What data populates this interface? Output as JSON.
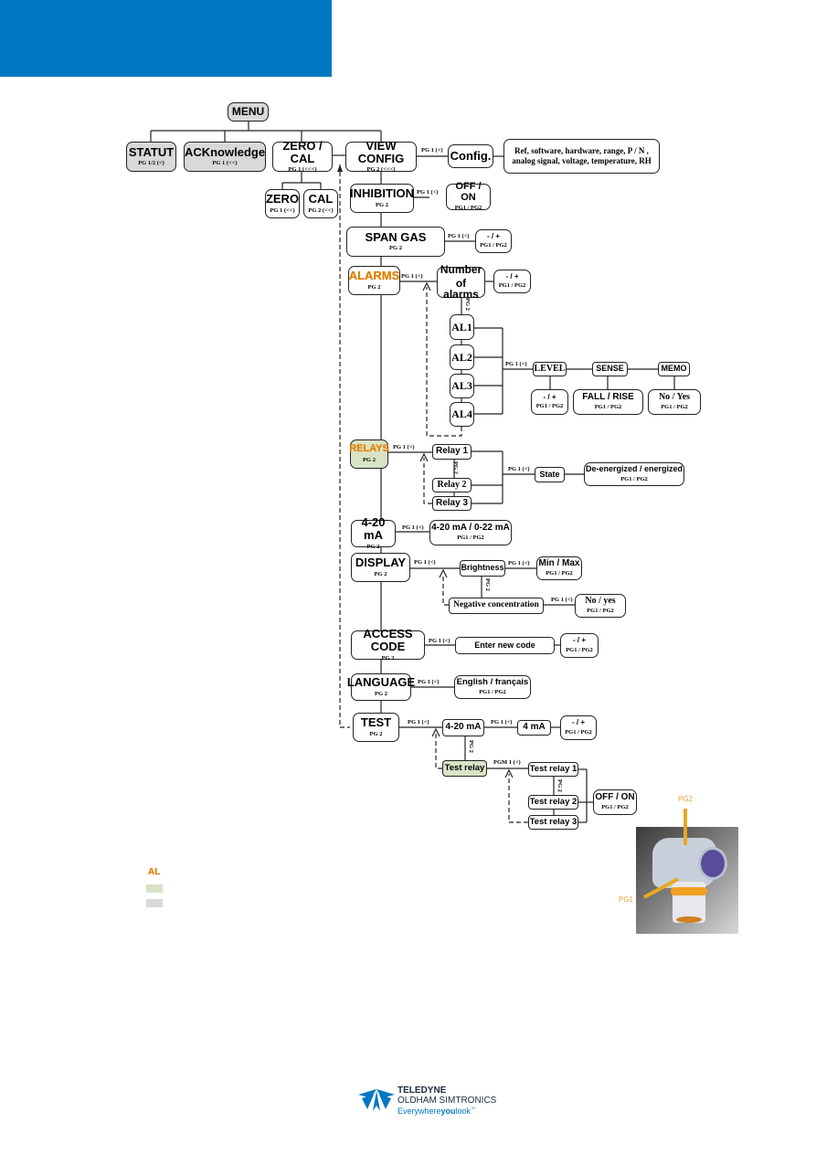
{
  "menu": {
    "title": "MENU"
  },
  "top_items": [
    {
      "label": "STATUT",
      "sub": "PG 1/2 (<)"
    },
    {
      "label": "ACKnowledge",
      "sub": "PG 1 (<<)"
    },
    {
      "label": "ZERO / CAL",
      "sub": "PG 1 (<<<)"
    },
    {
      "label": "VIEW CONFIG",
      "sub": "PG 2 (<<<)"
    }
  ],
  "zero_cal_children": [
    {
      "label": "ZERO",
      "sub": "PG 1 (<<)"
    },
    {
      "label": "CAL",
      "sub": "PG 2 (<<)"
    }
  ],
  "view_config": {
    "link": "PG 1 (<)",
    "config": "Config.",
    "details_line1": "Ref, software, hardware, range, P / N ,",
    "details_line2": "analog signal, voltage, temperature, RH"
  },
  "inhibition": {
    "label": "INHIBITION",
    "sub": "PG 2",
    "link": "PG 1 (<)",
    "option": "OFF / ON",
    "option_sub": "PG1 / PG2"
  },
  "span_gas": {
    "label": "SPAN GAS",
    "sub": "PG 2",
    "link": "PG 1 (<)",
    "option": "- / +",
    "option_sub": "PG1 / PG2"
  },
  "alarms": {
    "label": "ALARMS",
    "sub": "PG 2",
    "link": "PG 1 (<)",
    "number_line1": "Number",
    "number_line2": "of alarms",
    "number_option": "- / +",
    "number_option_sub": "PG1 / PG2",
    "vlink": "PG 2",
    "levels": [
      "AL1",
      "AL2",
      "AL3",
      "AL4"
    ],
    "al_link": "PG 1 (<)",
    "level": "LEVEL",
    "sense": "SENSE",
    "memo": "MEMO",
    "level_option": "- / +",
    "level_option_sub": "PG1 / PG2",
    "sense_option": "FALL / RISE",
    "sense_option_sub": "PG1 / PG2",
    "memo_option": "No / Yes",
    "memo_option_sub": "PG1 / PG2"
  },
  "relays": {
    "label": "RELAYS",
    "sub": "PG 2",
    "link": "PG 1 (<)",
    "items": [
      "Relay 1",
      "Relay 2",
      "Relay 3"
    ],
    "vlink": "PG 2",
    "state_link": "PG 1 (<)",
    "state": "State",
    "state_option": "De-energized / energized",
    "state_option_sub": "PG1 / PG2"
  },
  "current": {
    "label": "4-20 mA",
    "sub": "PG 2",
    "link": "PG 1 (<)",
    "option": "4-20 mA / 0-22 mA",
    "option_sub": "PG1 / PG2"
  },
  "display": {
    "label": "DISPLAY",
    "sub": "PG 2",
    "link": "PG 1 (<)",
    "brightness": "Brightness",
    "brightness_link": "PG 1 (<)",
    "brightness_option": "Min  / Max",
    "brightness_option_sub": "PG1 / PG2",
    "vlink": "PG 2",
    "negative": "Negative concentration",
    "negative_link": "PG 1 (<)",
    "negative_option": "No / yes",
    "negative_option_sub": "PG1 / PG2"
  },
  "access_code": {
    "label": "ACCESS CODE",
    "sub": "PG 2",
    "link": "PG 1 (<)",
    "enter": "Enter new code",
    "option": "- / +",
    "option_sub": "PG1 / PG2"
  },
  "language": {
    "label": "LANGUAGE",
    "sub": "PG 2",
    "link": "PG 1 (<)",
    "option": "English / français",
    "option_sub": "PG1 / PG2"
  },
  "test": {
    "label": "TEST",
    "sub": "PG 2",
    "link": "PG 1 (<)",
    "ma": "4-20 mA",
    "ma_link": "PG 1 (<)",
    "four_ma": "4 mA",
    "ma_option": "- / +",
    "ma_option_sub": "PG1 / PG2",
    "vlink": "PG 2",
    "test_relay": "Test relay",
    "test_relay_link": "PGM 1 (<)",
    "test_relays": [
      "Test relay 1",
      "Test relay 2",
      "Test relay 3"
    ],
    "test_relays_vlink": "PG 2",
    "relay_option": "OFF / ON",
    "relay_option_sub": "PG1 / PG2"
  },
  "legend": {
    "al_sample": "AL",
    "green_hex": "#d9e3c6",
    "gray_hex": "#d9d9d9"
  },
  "photo": {
    "pg2": "PG2",
    "pg1": "PG1"
  },
  "logo": {
    "line1": "TELEDYNE",
    "line2": "OLDHAM SIMTRONICS",
    "tag_a": "Everywhere",
    "tag_b": "you",
    "tag_c": "look",
    "tm": "™"
  },
  "colors": {
    "header_blue": "#0077c0",
    "accent_orange": "#e07b00"
  }
}
